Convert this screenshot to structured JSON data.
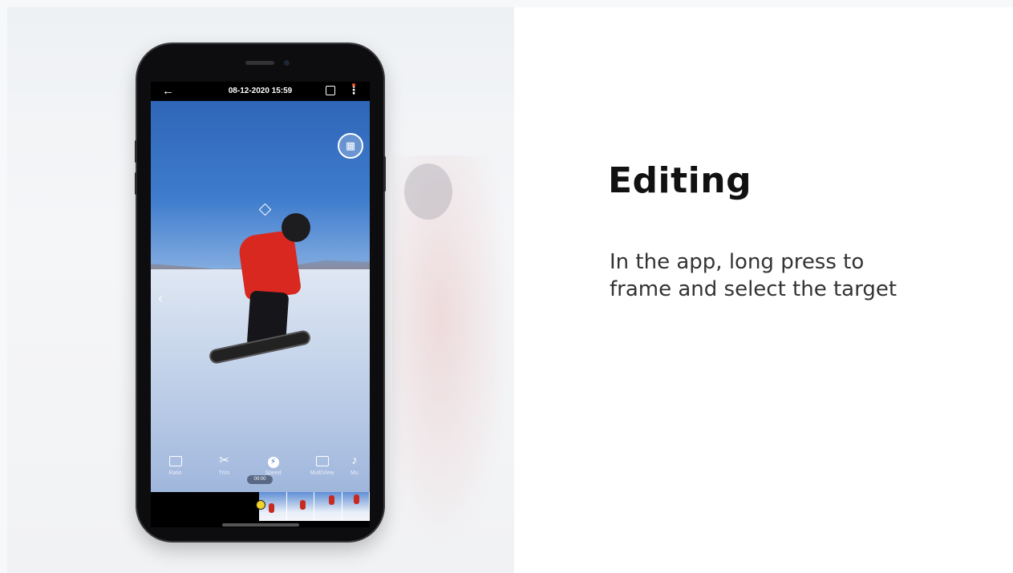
{
  "phone": {
    "datetime": "08-12-2020 15:59",
    "duration": "00:00",
    "tools": [
      {
        "label": "Ratio",
        "icon": "ratio-icon"
      },
      {
        "label": "Trim",
        "icon": "scissors-icon"
      },
      {
        "label": "Speed",
        "icon": "speed-icon"
      },
      {
        "label": "MultiView",
        "icon": "multiview-icon"
      },
      {
        "label": "Mu",
        "icon": "music-icon"
      }
    ]
  },
  "content": {
    "heading": "Editing",
    "body": "In the app, long press to\nframe and select the target"
  }
}
